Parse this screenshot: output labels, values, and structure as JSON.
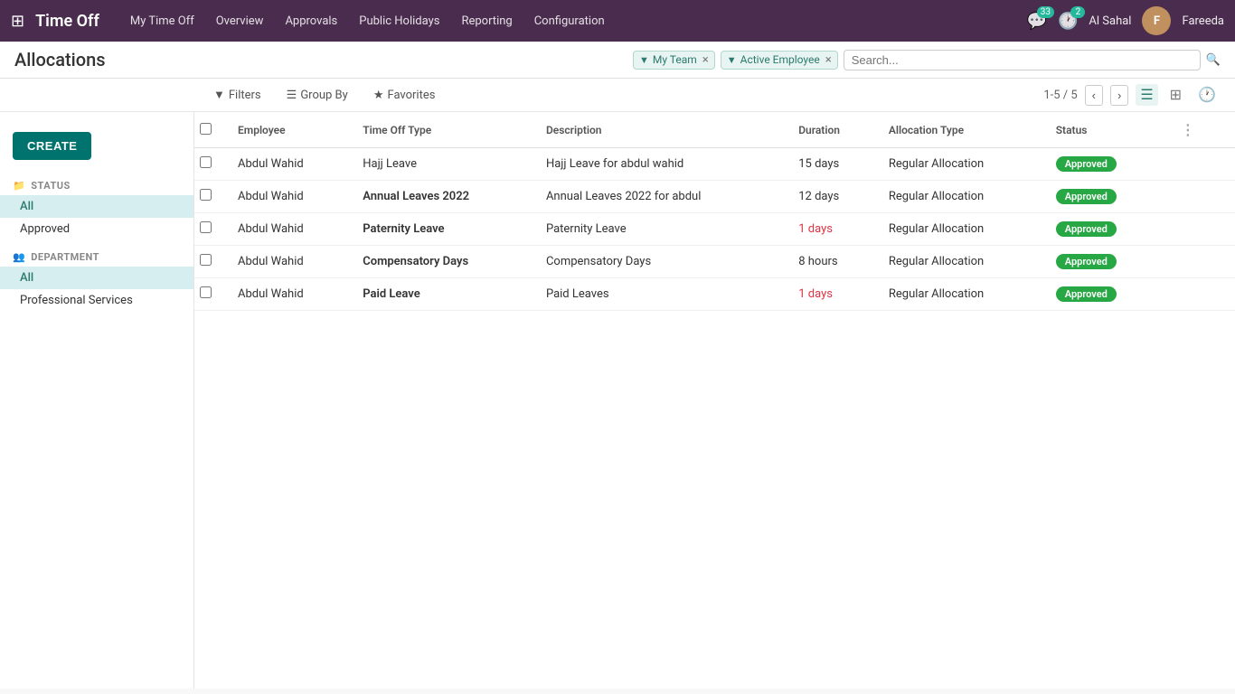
{
  "topnav": {
    "app_name": "Time Off",
    "nav_items": [
      {
        "label": "My Time Off"
      },
      {
        "label": "Overview"
      },
      {
        "label": "Approvals"
      },
      {
        "label": "Public Holidays"
      },
      {
        "label": "Reporting"
      },
      {
        "label": "Configuration"
      }
    ],
    "messages_count": "33",
    "activities_count": "2",
    "username": "Al Sahal",
    "avatar_label": "F",
    "avatar_name": "Fareeda"
  },
  "subheader": {
    "page_title": "Allocations",
    "filter_team_label": "My Team",
    "filter_employee_label": "Active Employee",
    "search_placeholder": "Search..."
  },
  "toolbar": {
    "filters_label": "Filters",
    "groupby_label": "Group By",
    "favorites_label": "Favorites",
    "page_info": "1-5 / 5"
  },
  "sidebar": {
    "create_btn": "CREATE",
    "status_header": "STATUS",
    "status_items": [
      {
        "label": "All",
        "active": true
      },
      {
        "label": "Approved",
        "active": false
      }
    ],
    "department_header": "DEPARTMENT",
    "department_items": [
      {
        "label": "All",
        "active": true
      },
      {
        "label": "Professional Services",
        "active": false
      }
    ]
  },
  "table": {
    "columns": [
      {
        "label": "Employee"
      },
      {
        "label": "Time Off Type"
      },
      {
        "label": "Description"
      },
      {
        "label": "Duration"
      },
      {
        "label": "Allocation Type"
      },
      {
        "label": "Status"
      }
    ],
    "rows": [
      {
        "employee": "Abdul Wahid",
        "time_off_type": "Hajj Leave",
        "type_bold": false,
        "description": "Hajj Leave for abdul wahid",
        "duration": "15 days",
        "duration_red": false,
        "allocation_type": "Regular Allocation",
        "status": "Approved"
      },
      {
        "employee": "Abdul Wahid",
        "time_off_type": "Annual Leaves 2022",
        "type_bold": true,
        "description": "Annual Leaves 2022 for abdul",
        "duration": "12 days",
        "duration_red": false,
        "allocation_type": "Regular Allocation",
        "status": "Approved"
      },
      {
        "employee": "Abdul Wahid",
        "time_off_type": "Paternity Leave",
        "type_bold": true,
        "description": "Paternity Leave",
        "duration": "1 days",
        "duration_red": true,
        "allocation_type": "Regular Allocation",
        "status": "Approved"
      },
      {
        "employee": "Abdul Wahid",
        "time_off_type": "Compensatory Days",
        "type_bold": true,
        "description": "Compensatory Days",
        "duration": "8 hours",
        "duration_red": false,
        "allocation_type": "Regular Allocation",
        "status": "Approved"
      },
      {
        "employee": "Abdul Wahid",
        "time_off_type": "Paid Leave",
        "type_bold": true,
        "description": "Paid Leaves",
        "duration": "1 days",
        "duration_red": true,
        "allocation_type": "Regular Allocation",
        "status": "Approved"
      }
    ]
  }
}
